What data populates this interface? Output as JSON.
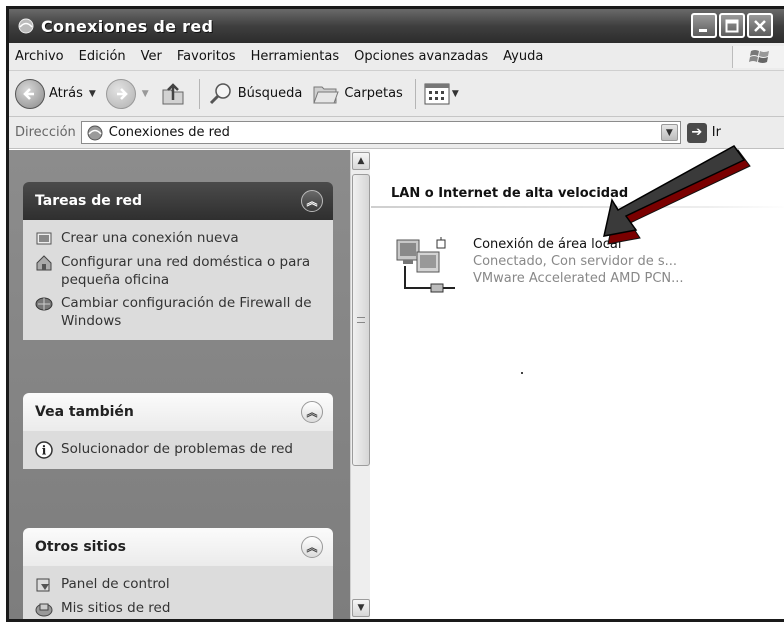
{
  "window": {
    "title": "Conexiones de red"
  },
  "menu": [
    "Archivo",
    "Edición",
    "Ver",
    "Favoritos",
    "Herramientas",
    "Opciones avanzadas",
    "Ayuda"
  ],
  "toolbar": {
    "back_label": "Atrás",
    "search_label": "Búsqueda",
    "folders_label": "Carpetas"
  },
  "address": {
    "label": "Dirección",
    "value": "Conexiones de red",
    "go_label": "Ir"
  },
  "tasks": {
    "title": "Tareas de red",
    "items": [
      "Crear una conexión nueva",
      "Configurar una red doméstica o para pequeña oficina",
      "Cambiar configuración de Firewall de Windows"
    ]
  },
  "see_also": {
    "title": "Vea también",
    "items": [
      "Solucionador de problemas de red"
    ]
  },
  "other_places": {
    "title": "Otros sitios",
    "items": [
      "Panel de control",
      "Mis sitios de red"
    ]
  },
  "content": {
    "group": "LAN o Internet de alta velocidad",
    "connection": {
      "name": "Conexión de área local",
      "status": "Conectado, Con servidor de s...",
      "device": "VMware Accelerated AMD PCN..."
    }
  },
  "colors": {
    "titlebar": "#3f3f3f",
    "pane": "#8c8c8c",
    "panel_body": "#dcdcdc",
    "arrow": "#3a3a3a"
  }
}
